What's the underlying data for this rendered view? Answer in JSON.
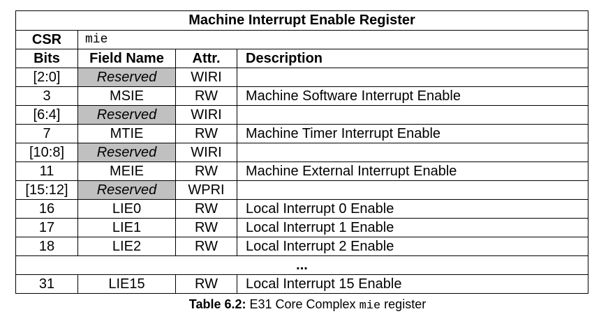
{
  "table": {
    "title": "Machine Interrupt Enable Register",
    "csr_label": "CSR",
    "csr_value": "mie",
    "headers": {
      "bits": "Bits",
      "field_name": "Field Name",
      "attr": "Attr.",
      "description": "Description"
    },
    "rows": [
      {
        "bits": "[2:0]",
        "field": "Reserved",
        "attr": "WIRI",
        "desc": "",
        "reserved": true
      },
      {
        "bits": "3",
        "field": "MSIE",
        "attr": "RW",
        "desc": "Machine Software Interrupt Enable",
        "reserved": false
      },
      {
        "bits": "[6:4]",
        "field": "Reserved",
        "attr": "WIRI",
        "desc": "",
        "reserved": true
      },
      {
        "bits": "7",
        "field": "MTIE",
        "attr": "RW",
        "desc": "Machine Timer Interrupt Enable",
        "reserved": false
      },
      {
        "bits": "[10:8]",
        "field": "Reserved",
        "attr": "WIRI",
        "desc": "",
        "reserved": true
      },
      {
        "bits": "11",
        "field": "MEIE",
        "attr": "RW",
        "desc": "Machine External Interrupt Enable",
        "reserved": false
      },
      {
        "bits": "[15:12]",
        "field": "Reserved",
        "attr": "WPRI",
        "desc": "",
        "reserved": true
      },
      {
        "bits": "16",
        "field": "LIE0",
        "attr": "RW",
        "desc": "Local Interrupt 0 Enable",
        "reserved": false
      },
      {
        "bits": "17",
        "field": "LIE1",
        "attr": "RW",
        "desc": "Local Interrupt 1 Enable",
        "reserved": false
      },
      {
        "bits": "18",
        "field": "LIE2",
        "attr": "RW",
        "desc": "Local Interrupt 2 Enable",
        "reserved": false
      }
    ],
    "ellipsis": "...",
    "last_row": {
      "bits": "31",
      "field": "LIE15",
      "attr": "RW",
      "desc": "Local Interrupt 15 Enable"
    }
  },
  "caption": {
    "label": "Table 6.2:",
    "text_before": " E31 Core Complex ",
    "code": "mie",
    "text_after": " register"
  },
  "colors": {
    "reserved_fill": "#c0c0c0",
    "border": "#000000"
  }
}
